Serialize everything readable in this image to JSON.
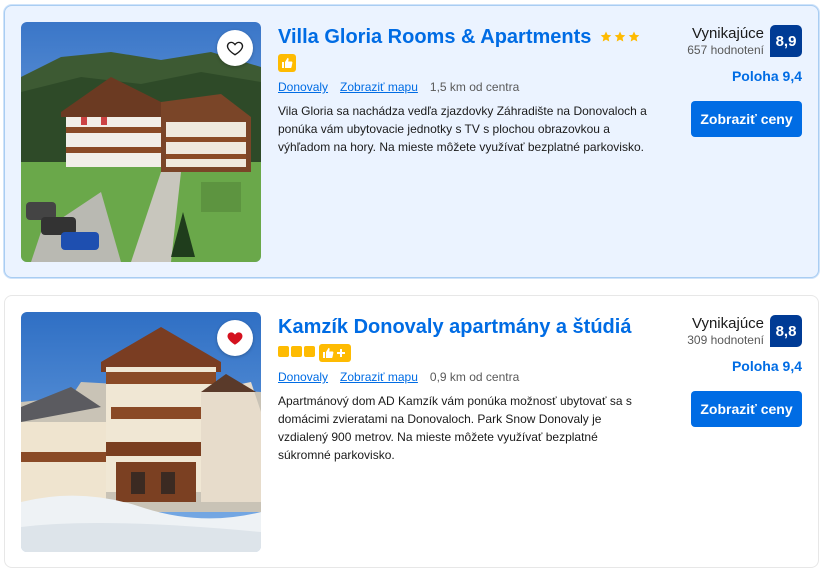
{
  "colors": {
    "brand_blue": "#006ce4",
    "score_blue": "#003b95",
    "star_yellow": "#febb02",
    "heart_red": "#d4111e"
  },
  "listings": [
    {
      "name": "Villa Gloria Rooms & Apartments",
      "stars": 3,
      "preferred_icon": "thumbs-up-icon",
      "location": "Donovaly",
      "map_link": "Zobraziť mapu",
      "distance": "1,5 km od centra",
      "description": "Vila Gloria sa nachádza vedľa zjazdovky Záhradište na Donovaloch a ponúka vám ubytovacie jednotky s TV s plochou obrazovkou a výhľadom na hory. Na mieste môžete využívať bezplatné parkovisko.",
      "review_word": "Vynikajúce",
      "review_count": "657 hodnotení",
      "score": "8,9",
      "location_score": "Poloha 9,4",
      "cta": "Zobraziť ceny",
      "favorite": false
    },
    {
      "name": "Kamzík Donovaly apartmány a štúdiá",
      "stars": 3,
      "preferred_icon": "thumbs-up-plus-icon",
      "location": "Donovaly",
      "map_link": "Zobraziť mapu",
      "distance": "0,9 km od centra",
      "description": "Apartmánový dom AD Kamzík vám ponúka možnosť ubytovať sa s domácimi zvieratami na Donovaloch. Park Snow Donovaly je vzdialený 900 metrov. Na mieste môžete využívať bezplatné súkromné parkovisko.",
      "review_word": "Vynikajúce",
      "review_count": "309 hodnotení",
      "score": "8,8",
      "location_score": "Poloha 9,4",
      "cta": "Zobraziť ceny",
      "favorite": true
    }
  ]
}
